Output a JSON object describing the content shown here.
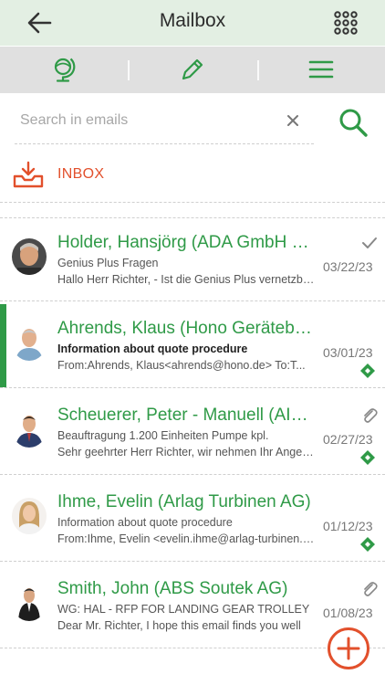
{
  "header": {
    "title": "Mailbox"
  },
  "icons": {
    "back": "back-arrow-icon",
    "apps": "apps-grid-icon",
    "globe": "globe-icon",
    "compose": "pencil-icon",
    "menu": "hamburger-menu-icon",
    "search": "search-icon",
    "clear": "clear-icon",
    "inbox": "inbox-download-icon",
    "add": "plus-icon"
  },
  "colors": {
    "accent_green": "#2f9a47",
    "accent_orange": "#e2502c",
    "header_bg": "#e3efe3",
    "toolbar_bg": "#e0e0e0"
  },
  "search": {
    "placeholder": "Search in emails",
    "value": ""
  },
  "folder": {
    "label": "INBOX"
  },
  "emails": [
    {
      "sender": "Holder, Hansjörg (ADA GmbH & Co. KG)",
      "subject": "Genius Plus Fragen",
      "preview": "Hallo Herr Richter, - Ist die Genius Plus vernetzbar?",
      "date": "03/22/23",
      "status_icon": "checkmark-icon",
      "crm_icon": "",
      "unread": false
    },
    {
      "sender": "Ahrends, Klaus (Hono Gerätebau GmbH)",
      "subject": "Information about quote procedure",
      "preview": "From:Ahrends, Klaus<ahrends@hono.de> To:T...",
      "date": "03/01/23",
      "status_icon": "",
      "crm_icon": "crm-link-icon",
      "unread": true
    },
    {
      "sender": "Scheuerer, Peter - Manuell (AIM GmbH)",
      "subject": "Beauftragung 1.200 Einheiten Pumpe kpl.",
      "preview": "Sehr geehrter Herr Richter, wir nehmen Ihr Angebot",
      "date": "02/27/23",
      "status_icon": "paperclip-icon",
      "crm_icon": "crm-link-icon",
      "unread": false
    },
    {
      "sender": "Ihme, Evelin (Arlag Turbinen AG)",
      "subject": "Information about quote procedure",
      "preview": "From:Ihme, Evelin <evelin.ihme@arlag-turbinen.de>",
      "date": "01/12/23",
      "status_icon": "",
      "crm_icon": "crm-link-icon",
      "unread": false
    },
    {
      "sender": "Smith, John (ABS Soutek AG)",
      "subject": "WG: HAL - RFP FOR LANDING GEAR TROLLEY",
      "preview": "Dear Mr. Richter, I hope this email finds you well",
      "date": "01/08/23",
      "status_icon": "paperclip-icon",
      "crm_icon": "",
      "unread": false
    }
  ]
}
